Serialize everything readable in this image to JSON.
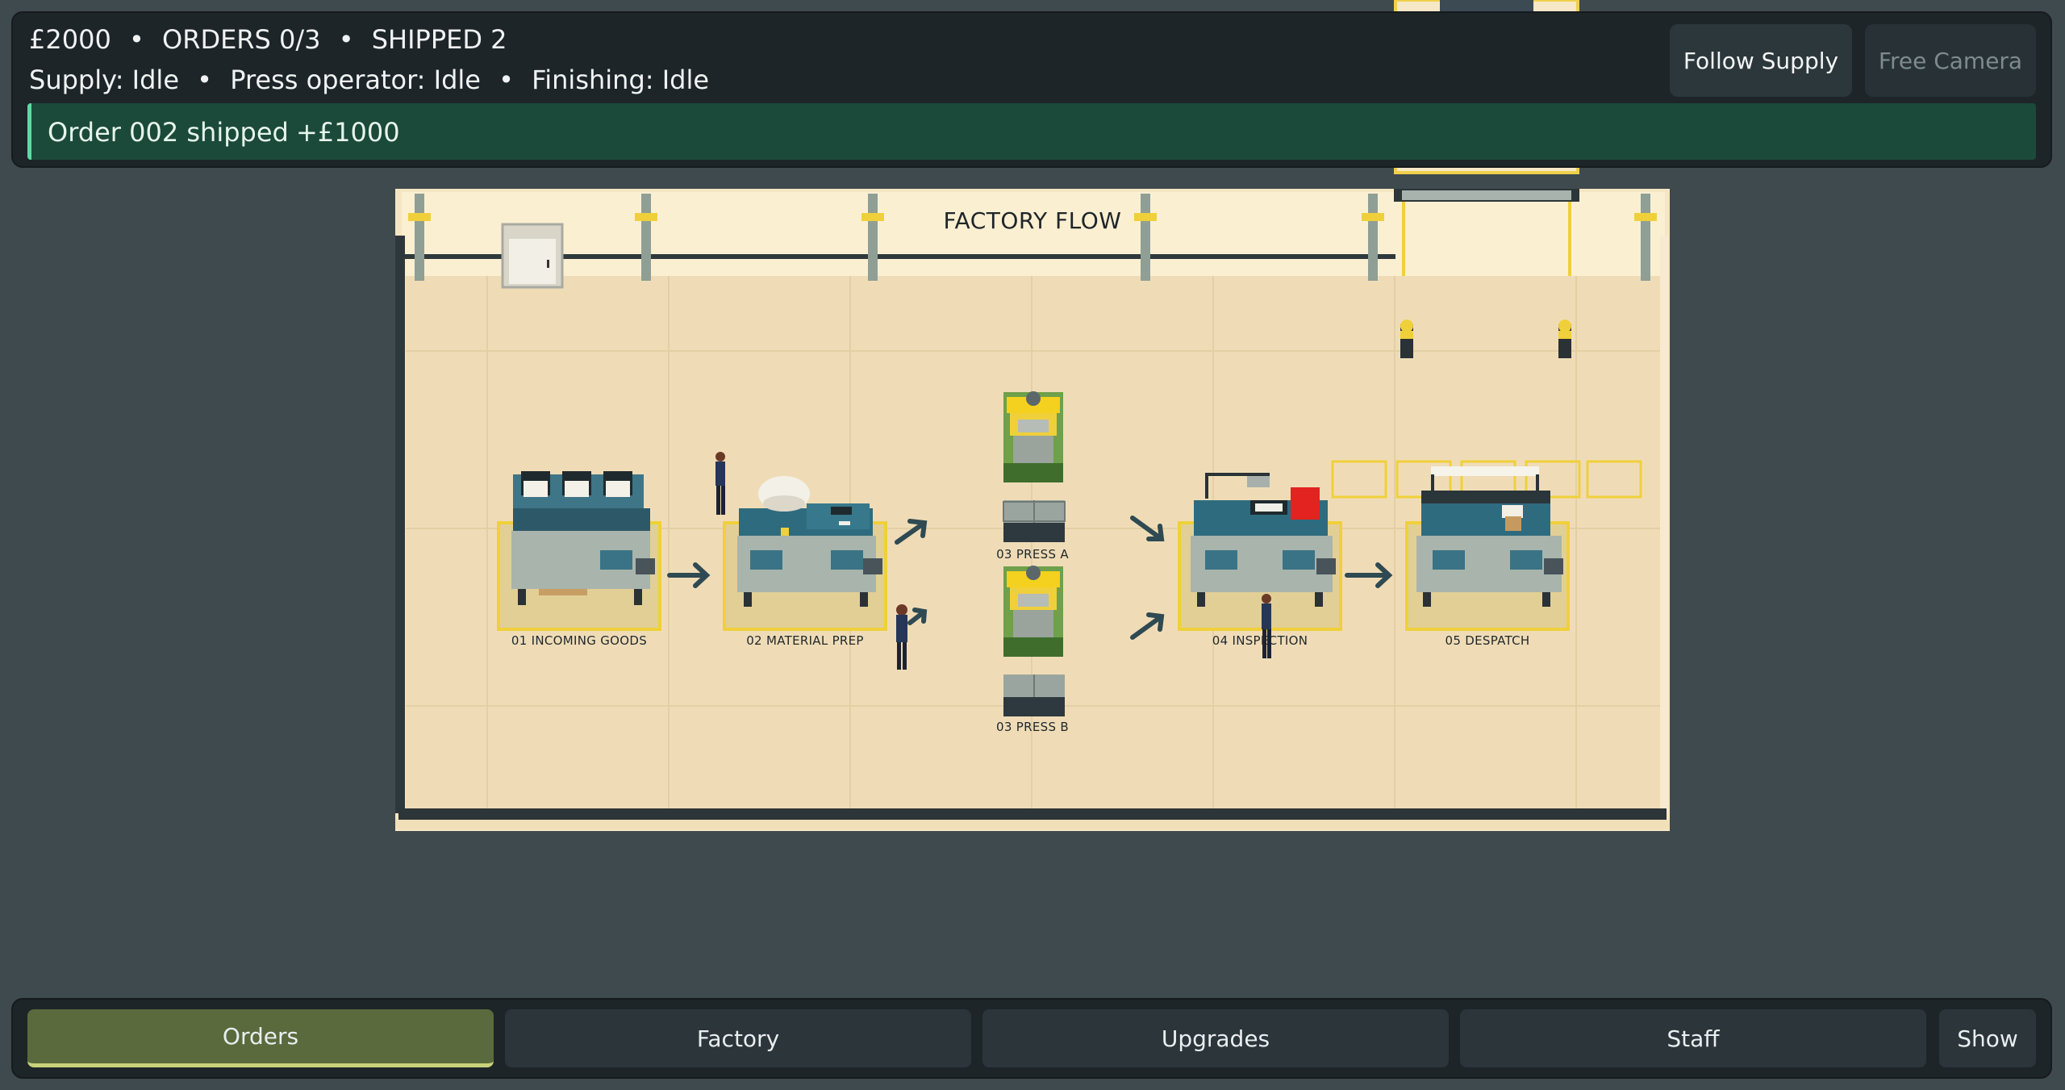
{
  "hud": {
    "money": "£2000",
    "orders": "ORDERS 0/3",
    "shipped": "SHIPPED 2",
    "separator": "•",
    "supply_status": "Supply: Idle",
    "press_status": "Press operator: Idle",
    "finishing_status": "Finishing: Idle",
    "toast_message": "Order 002 shipped",
    "toast_amount": "+£1000",
    "follow_label": "Follow Supply",
    "free_camera_label": "Free Camera"
  },
  "factory": {
    "title": "FACTORY FLOW",
    "stations": [
      "01  INCOMING GOODS",
      "02  MATERIAL PREP",
      "03  PRESS A",
      "03  PRESS B",
      "04  INSPECTION",
      "05  DESPATCH"
    ]
  },
  "tabs": {
    "orders": "Orders",
    "factory": "Factory",
    "upgrades": "Upgrades",
    "staff": "Staff",
    "show": "Show"
  },
  "colors": {
    "background": "#3f4a4e",
    "panel": "#1d2529",
    "toast": "#1c4a3a",
    "floor": "#efdcb7",
    "accent_yellow": "#f2d033",
    "active_tab": "#5b6a3c"
  }
}
